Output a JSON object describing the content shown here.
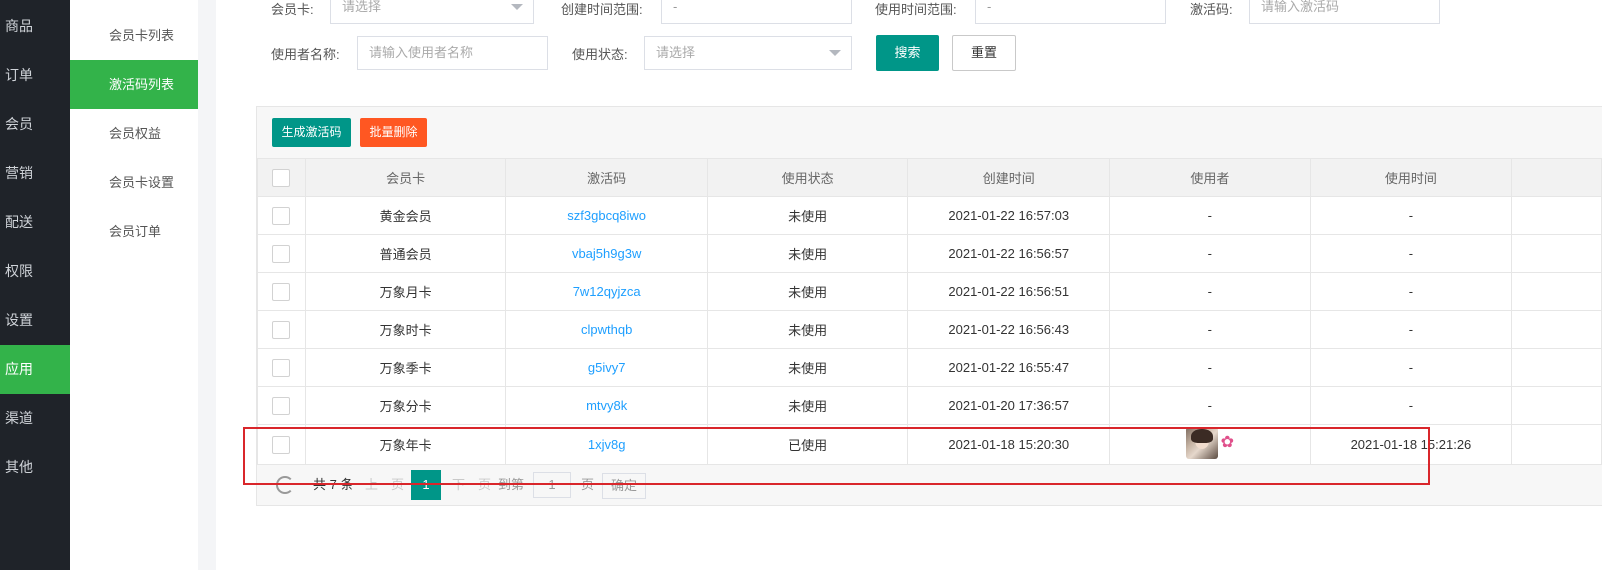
{
  "nav": {
    "items": [
      {
        "label": "商品",
        "active": false
      },
      {
        "label": "订单",
        "active": false
      },
      {
        "label": "会员",
        "active": false
      },
      {
        "label": "营销",
        "active": false
      },
      {
        "label": "配送",
        "active": false
      },
      {
        "label": "权限",
        "active": false
      },
      {
        "label": "设置",
        "active": false
      },
      {
        "label": "应用",
        "active": true
      },
      {
        "label": "渠道",
        "active": false
      },
      {
        "label": "其他",
        "active": false
      }
    ]
  },
  "subnav": {
    "items": [
      {
        "label": "会员卡列表",
        "active": false
      },
      {
        "label": "激活码列表",
        "active": true
      },
      {
        "label": "会员权益",
        "active": false
      },
      {
        "label": "会员卡设置",
        "active": false
      },
      {
        "label": "会员订单",
        "active": false
      }
    ]
  },
  "filters": {
    "card_label": "会员卡:",
    "card_placeholder": "请选择",
    "created_label": "创建时间范围:",
    "created_value": "-",
    "used_time_label": "使用时间范围:",
    "used_time_value": "-",
    "code_label": "激活码:",
    "code_placeholder": "请输入激活码",
    "user_label": "使用者名称:",
    "user_placeholder": "请输入使用者名称",
    "status_label": "使用状态:",
    "status_placeholder": "请选择",
    "search_button": "搜索",
    "reset_button": "重置"
  },
  "toolbar": {
    "generate_button": "生成激活码",
    "bulk_delete_button": "批量删除",
    "generate_color": "#009688",
    "delete_color": "#ff5722"
  },
  "table": {
    "columns": [
      "会员卡",
      "激活码",
      "使用状态",
      "创建时间",
      "使用者",
      "使用时间"
    ],
    "rows": [
      {
        "card": "黄金会员",
        "code": "szf3gbcq8iwo",
        "status": "未使用",
        "created": "2021-01-22 16:57:03",
        "user": "-",
        "used_time": "-"
      },
      {
        "card": "普通会员",
        "code": "vbaj5h9g3w",
        "status": "未使用",
        "created": "2021-01-22 16:56:57",
        "user": "-",
        "used_time": "-"
      },
      {
        "card": "万象月卡",
        "code": "7w12qyjzca",
        "status": "未使用",
        "created": "2021-01-22 16:56:51",
        "user": "-",
        "used_time": "-"
      },
      {
        "card": "万象时卡",
        "code": "clpwthqb",
        "status": "未使用",
        "created": "2021-01-22 16:56:43",
        "user": "-",
        "used_time": "-"
      },
      {
        "card": "万象季卡",
        "code": "g5ivy7",
        "status": "未使用",
        "created": "2021-01-22 16:55:47",
        "user": "-",
        "used_time": "-"
      },
      {
        "card": "万象分卡",
        "code": "mtvy8k",
        "status": "未使用",
        "created": "2021-01-20 17:36:57",
        "user": "-",
        "used_time": "-"
      },
      {
        "card": "万象年卡",
        "code": "1xjv8g",
        "status": "已使用",
        "created": "2021-01-18 15:20:30",
        "user_avatar": "avatar-photo",
        "user_name_icon": "flower-icon",
        "used_time": "2021-01-18 15:21:26"
      }
    ]
  },
  "pager": {
    "total": "共 7 条",
    "prev": "上一页",
    "current": "1",
    "next": "下一页",
    "goto_label": "到第",
    "goto_value": "1",
    "page_suffix": "页",
    "confirm": "确定"
  }
}
